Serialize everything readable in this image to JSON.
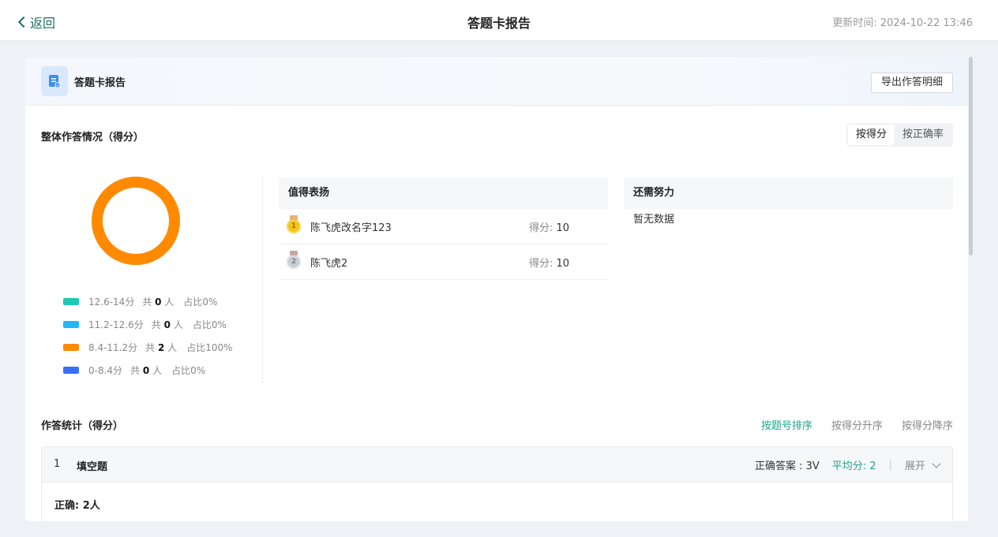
{
  "topbar": {
    "back_label": "返回",
    "title": "答题卡报告",
    "update_time": "更新时间: 2024-10-22 13:46"
  },
  "card": {
    "title": "答题卡报告",
    "export_label": "导出作答明细"
  },
  "overview": {
    "title": "整体作答情况（得分）",
    "toggle": [
      "按得分",
      "按正确率"
    ],
    "legend": [
      {
        "range": "12.6-14分",
        "prefix": "共",
        "count": "0",
        "suffix": "人",
        "pct": "占比0%",
        "color": "#1ccbb4"
      },
      {
        "range": "11.2-12.6分",
        "prefix": "共",
        "count": "0",
        "suffix": "人",
        "pct": "占比0%",
        "color": "#20b9f3"
      },
      {
        "range": "8.4-11.2分",
        "prefix": "共",
        "count": "2",
        "suffix": "人",
        "pct": "占比100%",
        "color": "#ff8a00"
      },
      {
        "range": "0-8.4分",
        "prefix": "共",
        "count": "0",
        "suffix": "人",
        "pct": "占比0%",
        "color": "#3671f5"
      }
    ],
    "donut_color": "#ff8a00"
  },
  "praise": {
    "title": "值得表扬",
    "score_label": "得分:",
    "rows": [
      {
        "rank": "1",
        "name": "陈飞虎改名字123",
        "score": "10"
      },
      {
        "rank": "2",
        "name": "陈飞虎2",
        "score": "10"
      }
    ]
  },
  "effort": {
    "title": "还需努力",
    "empty": "暂无数据"
  },
  "stats": {
    "title": "作答统计（得分）",
    "sort": [
      "按题号排序",
      "按得分升序",
      "按得分降序"
    ],
    "question": {
      "num": "1",
      "type": "填空题",
      "answer": "正确答案 : 3V",
      "avg": "平均分:  2",
      "sep": "|",
      "expand": "展开",
      "correct": "正确: 2人"
    }
  }
}
